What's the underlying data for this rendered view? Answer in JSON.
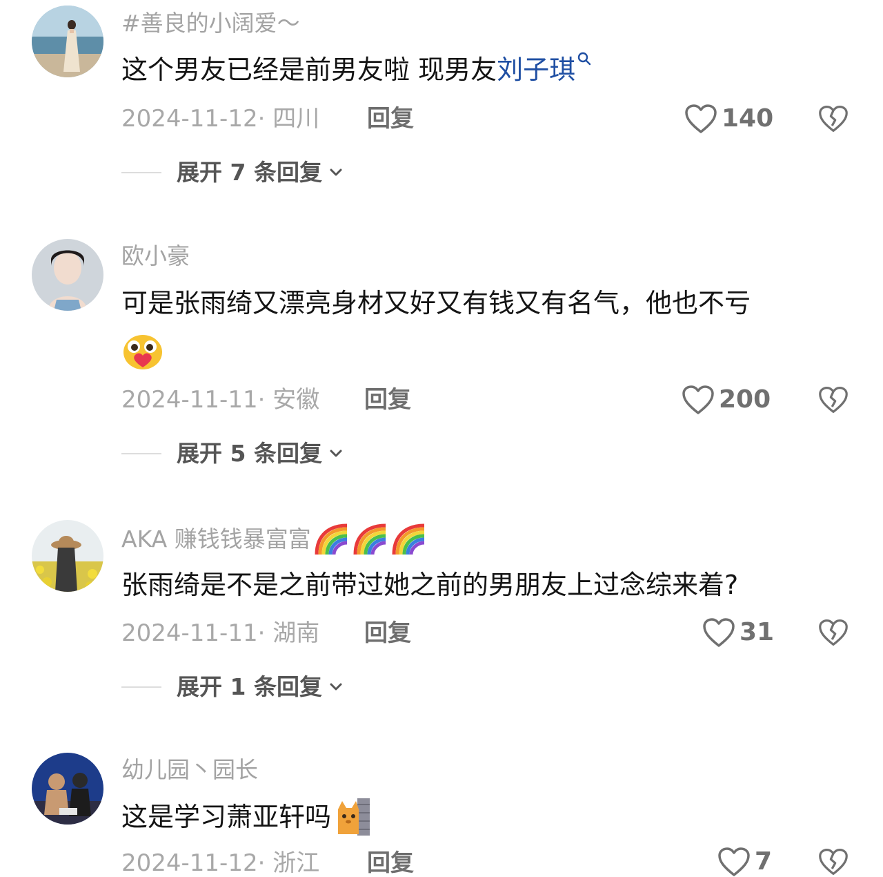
{
  "comments": [
    {
      "username": "#善良的小阔爱～",
      "text": "这个男友已经是前男友啦 现男友",
      "mention": "刘子琪",
      "date_location": "2024-11-12· 四川",
      "reply_label": "回复",
      "likes": "140",
      "expand_label": "展开 7 条回复",
      "avatar_icon": "beach-woman-avatar"
    },
    {
      "username": "欧小豪",
      "text": "可是张雨绮又漂亮身材又好又有钱又有名气，他也不亏",
      "emoji": "hug-heart-emoji",
      "date_location": "2024-11-11· 安徽",
      "reply_label": "回复",
      "likes": "200",
      "expand_label": "展开 5 条回复",
      "avatar_icon": "woman-portrait-avatar"
    },
    {
      "username": "AKA 赚钱钱暴富富",
      "username_emoji": "rainbow-emoji",
      "text": "张雨绮是不是之前带过她之前的男朋友上过念综来着?",
      "date_location": "2024-11-11· 湖南",
      "reply_label": "回复",
      "likes": "31",
      "expand_label": "展开 1 条回复",
      "avatar_icon": "flower-field-avatar"
    },
    {
      "username": "幼儿园丶园长",
      "text": "这是学习萧亚轩吗",
      "emoji": "cat-peeking-emoji",
      "date_location": "2024-11-12· 浙江",
      "reply_label": "回复",
      "likes": "7",
      "avatar_icon": "figures-avatar"
    }
  ],
  "colors": {
    "text": "#141414",
    "muted": "#a8a8a8",
    "mention": "#1f4fa3",
    "icon": "#707070"
  }
}
